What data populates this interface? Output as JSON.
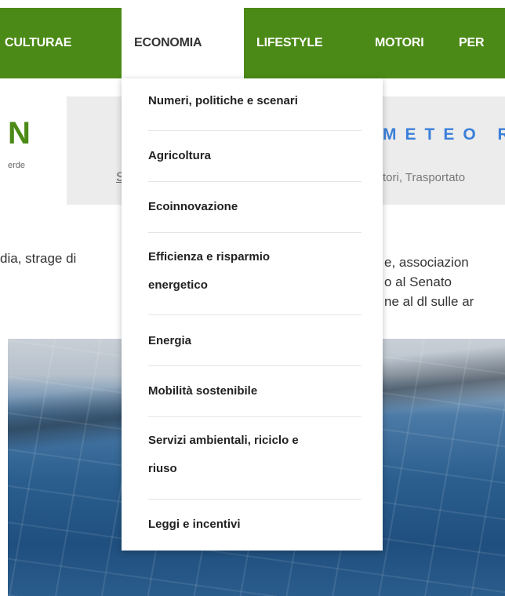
{
  "nav": {
    "items": [
      {
        "label": "CULTURAE"
      },
      {
        "label": "ECONOMIA"
      },
      {
        "label": "LIFESTYLE"
      },
      {
        "label": "MOTORI"
      },
      {
        "label": "PER"
      }
    ]
  },
  "header": {
    "logo_letter": "N",
    "logo_sub": "erde",
    "banner_letter": "S",
    "meteo_title": "METEO R",
    "meteo_sub": "tori, Trasportato"
  },
  "news": {
    "left_line": "dia, strage di",
    "right_lines": [
      "e, associazion",
      "o al Senato",
      "ne al dl sulle ar"
    ]
  },
  "dropdown": {
    "items": [
      {
        "lines": [
          "Numeri, politiche e scenari"
        ]
      },
      {
        "lines": [
          "Agricoltura"
        ]
      },
      {
        "lines": [
          "Ecoinnovazione"
        ]
      },
      {
        "lines": [
          "Efficienza e risparmio",
          "energetico"
        ]
      },
      {
        "lines": [
          "Energia"
        ]
      },
      {
        "lines": [
          "Mobilità sostenibile"
        ]
      },
      {
        "lines": [
          "Servizi ambientali, riciclo e",
          "riuso"
        ]
      },
      {
        "lines": [
          "Leggi e incentivi"
        ]
      }
    ]
  },
  "colors": {
    "nav_green": "#4b8a17",
    "meteo_blue": "#3b7fd9"
  }
}
